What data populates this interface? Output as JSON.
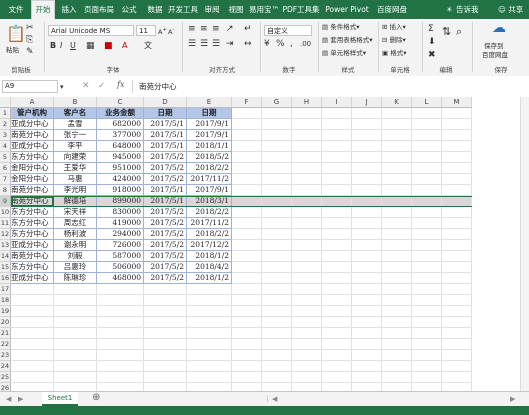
{
  "tabs": [
    "文件",
    "开始",
    "插入",
    "页面布局",
    "公式",
    "数据",
    "开发工具",
    "审阅",
    "视图",
    "易用宝™",
    "PDF工具集",
    "Power Pivot",
    "百度网盘"
  ],
  "active_tab": "开始",
  "tell_me": "告诉我",
  "share": "共享",
  "ribbon": {
    "font_name": "Arial Unicode MS",
    "font_size": "11",
    "number_format": "自定义",
    "groups": {
      "clipboard": "剪贴板",
      "font": "字体",
      "alignment": "对齐方式",
      "number": "数字",
      "styles": "样式",
      "cells": "单元格",
      "editing": "编辑",
      "save": "保存"
    },
    "style_buttons": [
      "条件格式",
      "套用表格格式",
      "单元格样式"
    ],
    "cell_buttons": [
      "插入",
      "删除",
      "格式"
    ],
    "save_button": [
      "保存到",
      "百度网盘"
    ],
    "paste_label": "粘贴"
  },
  "formula_bar": {
    "name_box": "A9",
    "fx": "fx",
    "content": "南苑分中心"
  },
  "columns": [
    "A",
    "B",
    "C",
    "D",
    "E",
    "F",
    "G",
    "H",
    "I",
    "J",
    "K",
    "L",
    "M"
  ],
  "table": {
    "headers": [
      "管户机构",
      "客户名",
      "业务金额",
      "日期",
      "日期"
    ],
    "rows": [
      [
        "亚成分中心",
        "孟雪",
        "682000",
        "2017/5/1",
        "2017/9/1"
      ],
      [
        "南苑分中心",
        "张宁一",
        "377000",
        "2017/5/1",
        "2017/9/1"
      ],
      [
        "亚成分中心",
        "李平",
        "648000",
        "2017/5/1",
        "2018/1/1"
      ],
      [
        "东方分中心",
        "向建荣",
        "945000",
        "2017/5/2",
        "2018/5/2"
      ],
      [
        "金阳分中心",
        "王爱华",
        "951000",
        "2017/5/2",
        "2018/2/2"
      ],
      [
        "金阳分中心",
        "马惠",
        "424000",
        "2017/5/2",
        "2017/11/2"
      ],
      [
        "南苑分中心",
        "李光明",
        "918000",
        "2017/5/1",
        "2017/9/1"
      ],
      [
        "南苑分中心",
        "解德培",
        "899000",
        "2017/5/1",
        "2018/3/1"
      ],
      [
        "东方分中心",
        "宋天祥",
        "830000",
        "2017/5/2",
        "2018/2/2"
      ],
      [
        "东方分中心",
        "周志红",
        "419000",
        "2017/5/2",
        "2017/11/2"
      ],
      [
        "东方分中心",
        "杨利波",
        "294000",
        "2017/5/2",
        "2018/2/2"
      ],
      [
        "亚成分中心",
        "谢永明",
        "726000",
        "2017/5/2",
        "2017/12/2"
      ],
      [
        "南苑分中心",
        "刘毅",
        "587000",
        "2017/5/2",
        "2018/1/2"
      ],
      [
        "东方分中心",
        "吕惠玲",
        "506000",
        "2017/5/2",
        "2018/4/2"
      ],
      [
        "亚成分中心",
        "陈琳珍",
        "468000",
        "2017/5/2",
        "2018/1/2"
      ]
    ]
  },
  "selected_row": 9,
  "sheet_tab": "Sheet1",
  "colors": {
    "accent": "#217346",
    "table_header": "#b4c6e7",
    "selection": "#d8d8d8"
  }
}
